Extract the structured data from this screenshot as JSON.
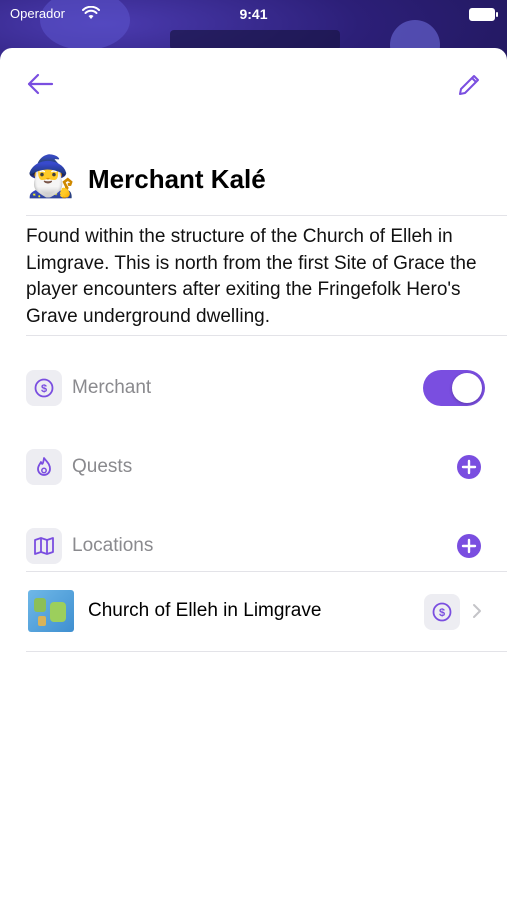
{
  "status_bar": {
    "carrier": "Operador",
    "time": "9:41"
  },
  "colors": {
    "accent": "#7a4ee0",
    "icon_bg": "#ededf2",
    "label_gray": "#8a8a8e"
  },
  "nav": {
    "back_icon": "arrow-left-icon",
    "edit_icon": "pencil-icon"
  },
  "character": {
    "avatar_emoji": "🧙‍♂️",
    "name": "Merchant Kalé",
    "description": "Found within the structure of the Church of Elleh in Limgrave. This is north from the first Site of Grace the player encounters after exiting the Fringefolk Hero's Grave underground dwelling."
  },
  "sections": {
    "merchant": {
      "label": "Merchant",
      "icon": "dollar-circle-icon",
      "enabled": true
    },
    "quests": {
      "label": "Quests",
      "icon": "flame-icon"
    },
    "locations": {
      "label": "Locations",
      "icon": "map-icon"
    }
  },
  "locations": [
    {
      "name": "Church of Elleh in Limgrave",
      "thumbnail_icon": "world-map-icon",
      "badge_icon": "dollar-circle-icon"
    }
  ]
}
